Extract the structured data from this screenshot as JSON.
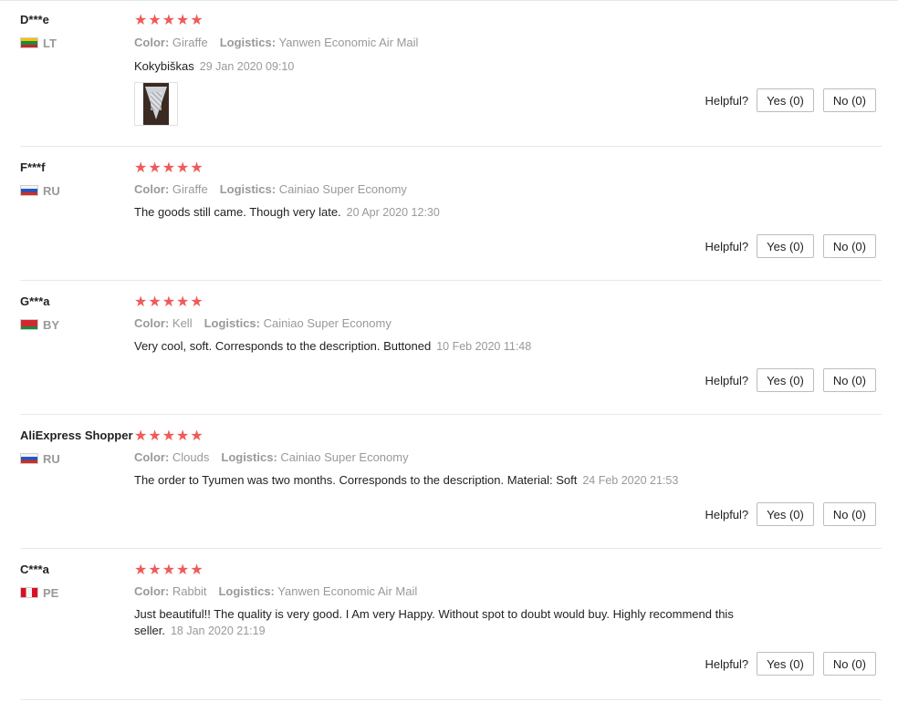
{
  "colors": {
    "star": "#f05a5a",
    "muted": "#999999",
    "border": "#e8e8e8"
  },
  "labels": {
    "color": "Color:",
    "logistics": "Logistics:",
    "helpful": "Helpful?"
  },
  "reviews": [
    {
      "user": "D***e",
      "country": "LT",
      "flag_icon": "lithuania-flag-icon",
      "rating": 5,
      "color": "Giraffe",
      "logistics": "Yanwen Economic Air Mail",
      "text": "Kokybiškas",
      "date": "29 Jan 2020 09:10",
      "has_photo": true,
      "yes": "Yes (0)",
      "no": "No (0)"
    },
    {
      "user": "F***f",
      "country": "RU",
      "flag_icon": "russia-flag-icon",
      "rating": 5,
      "color": "Giraffe",
      "logistics": "Cainiao Super Economy",
      "text": "The goods still came. Though very late.",
      "date": "20 Apr 2020 12:30",
      "yes": "Yes (0)",
      "no": "No (0)"
    },
    {
      "user": "G***a",
      "country": "BY",
      "flag_icon": "belarus-flag-icon",
      "rating": 5,
      "color": "Kell",
      "logistics": "Cainiao Super Economy",
      "text": "Very cool, soft. Corresponds to the description. Buttoned",
      "date": "10 Feb 2020 11:48",
      "yes": "Yes (0)",
      "no": "No (0)"
    },
    {
      "user": "AliExpress Shopper",
      "country": "RU",
      "flag_icon": "russia-flag-icon",
      "rating": 5,
      "color": "Clouds",
      "logistics": "Cainiao Super Economy",
      "text": "The order to Tyumen was two months. Corresponds to the description. Material: Soft",
      "date": "24 Feb 2020 21:53",
      "yes": "Yes (0)",
      "no": "No (0)"
    },
    {
      "user": "C***a",
      "country": "PE",
      "flag_icon": "peru-flag-icon",
      "rating": 5,
      "color": "Rabbit",
      "logistics": "Yanwen Economic Air Mail",
      "text": "Just beautiful!! The quality is very good. I Am very Happy. Without spot to doubt would buy. Highly recommend this seller.",
      "date": "18 Jan 2020 21:19",
      "yes": "Yes (0)",
      "no": "No (0)"
    }
  ]
}
